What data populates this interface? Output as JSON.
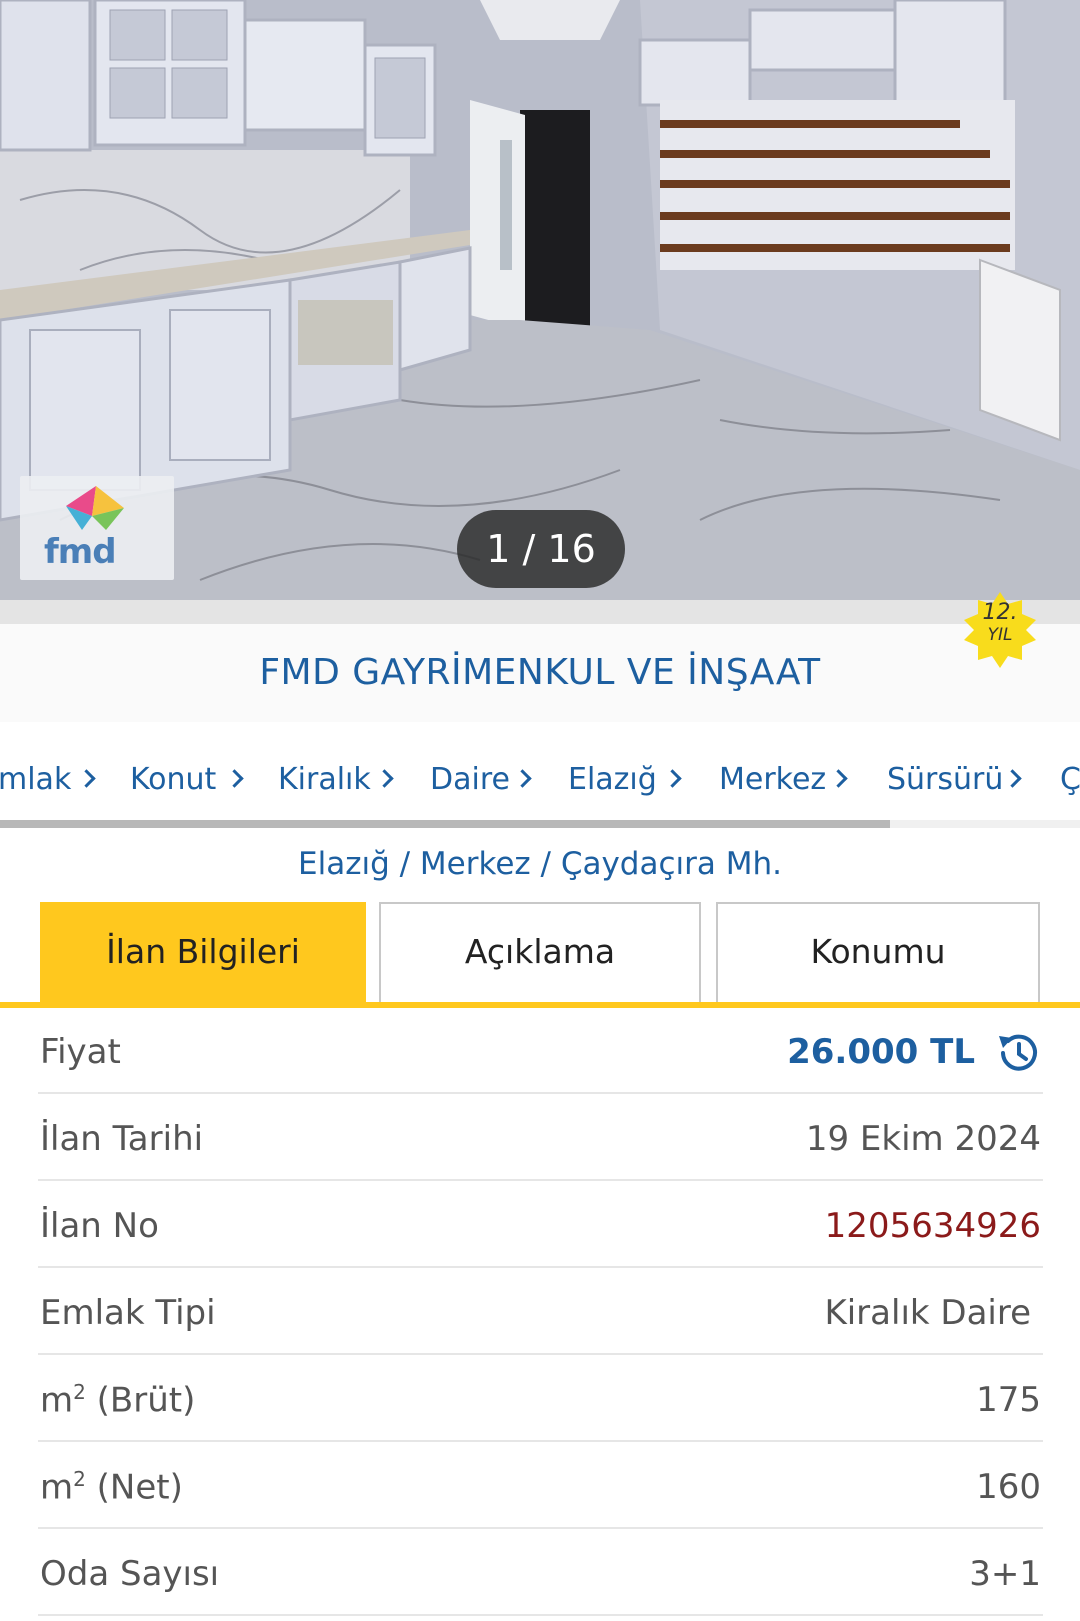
{
  "gallery": {
    "counter": "1 / 16",
    "logo_text": "fmd"
  },
  "store": {
    "name": "FMD GAYRİMENKUL VE İNŞAAT",
    "badge_number": "12.",
    "badge_label": "YIL"
  },
  "breadcrumb": [
    "mlak",
    "Konut",
    "Kiralık",
    "Daire",
    "Elazığ",
    "Merkez",
    "Sürsürü",
    "Ç"
  ],
  "location": "Elazığ / Merkez / Çaydaçıra Mh.",
  "tabs": [
    "İlan Bilgileri",
    "Açıklama",
    "Konumu"
  ],
  "details": {
    "price_label": "Fiyat",
    "price_value": "26.000 TL",
    "date_label": "İlan Tarihi",
    "date_value": "19 Ekim 2024",
    "no_label": "İlan No",
    "no_value": "1205634926",
    "type_label": "Emlak Tipi",
    "type_value": "Kiralık Daire",
    "gross_label": "m",
    "gross_suffix": " (Brüt)",
    "gross_value": "175",
    "net_label": "m",
    "net_suffix": " (Net)",
    "net_value": "160",
    "rooms_label": "Oda Sayısı",
    "rooms_value": "3+1"
  },
  "colors": {
    "accent": "#ffc81e",
    "link": "#1d5fa0",
    "ilan_no": "#8b1a1a"
  }
}
